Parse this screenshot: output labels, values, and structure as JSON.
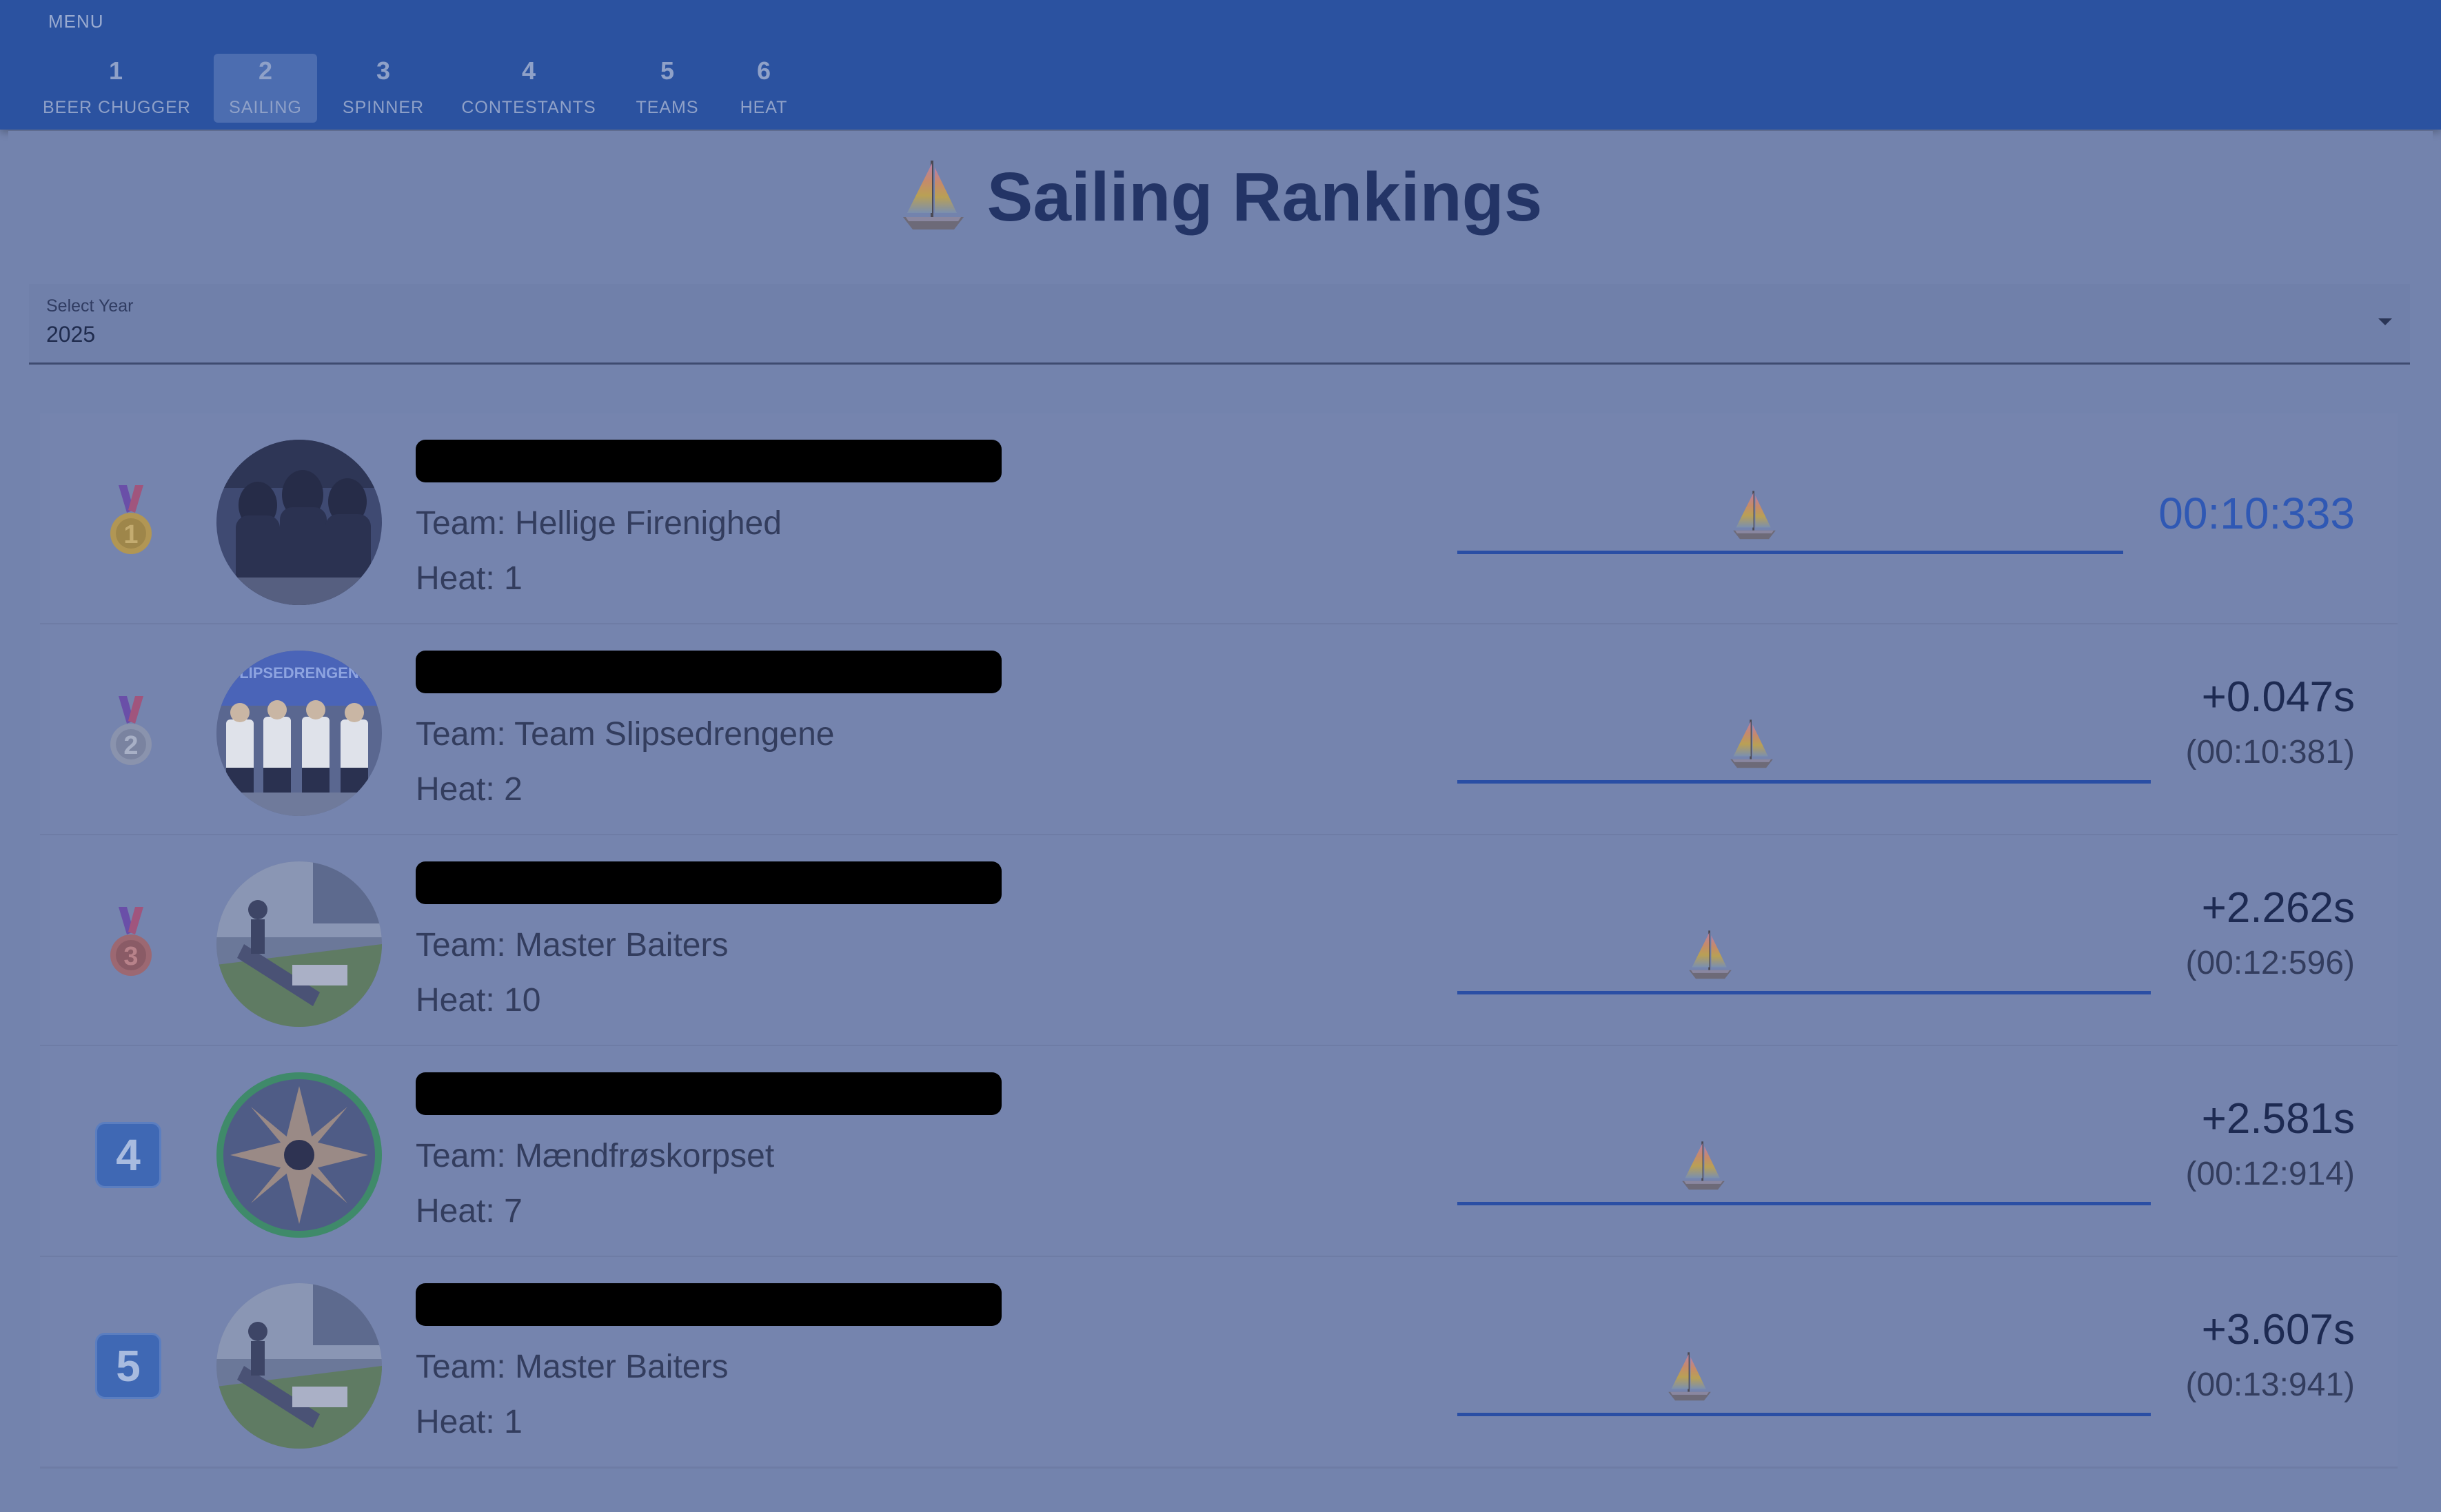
{
  "nav": {
    "menu_label": "MENU",
    "tabs": [
      {
        "number": "1",
        "label": "BEER CHUGGER",
        "active": false
      },
      {
        "number": "2",
        "label": "SAILING",
        "active": true
      },
      {
        "number": "3",
        "label": "SPINNER",
        "active": false
      },
      {
        "number": "4",
        "label": "CONTESTANTS",
        "active": false
      },
      {
        "number": "5",
        "label": "TEAMS",
        "active": false
      },
      {
        "number": "6",
        "label": "HEAT",
        "active": false
      }
    ]
  },
  "page": {
    "title": "Sailing Rankings",
    "title_icon": "sailboat-icon"
  },
  "year_select": {
    "label": "Select Year",
    "value": "2025"
  },
  "rankings": [
    {
      "rank": "1",
      "rank_icon": "gold-medal-icon",
      "name": "[redacted]",
      "team": "Team: Hellige Firenighed",
      "heat": "Heat: 1",
      "time": "00:10:333",
      "progress": 0.41
    },
    {
      "rank": "2",
      "rank_icon": "silver-medal-icon",
      "name": "[redacted]",
      "team": "Team: Team Slipsedrengene",
      "heat": "Heat: 2",
      "diff": "+0.047s",
      "abs_time": "(00:10:381)",
      "progress": 0.39
    },
    {
      "rank": "3",
      "rank_icon": "bronze-medal-icon",
      "name": "[redacted]",
      "team": "Team: Master Baiters",
      "heat": "Heat: 10",
      "diff": "+2.262s",
      "abs_time": "(00:12:596)",
      "progress": 0.33
    },
    {
      "rank": "4",
      "rank_icon": "keycap-4-icon",
      "name": "[redacted]",
      "team": "Team: Mændfrøskorpset",
      "heat": "Heat: 7",
      "diff": "+2.581s",
      "abs_time": "(00:12:914)",
      "progress": 0.32
    },
    {
      "rank": "5",
      "rank_icon": "keycap-5-icon",
      "name": "[redacted]",
      "team": "Team: Master Baiters",
      "heat": "Heat: 1",
      "diff": "+3.607s",
      "abs_time": "(00:13:941)",
      "progress": 0.3
    }
  ],
  "colors": {
    "appbar": "#2b52a0",
    "accent": "#2f58b4",
    "overlay_background": "#7383ad"
  }
}
